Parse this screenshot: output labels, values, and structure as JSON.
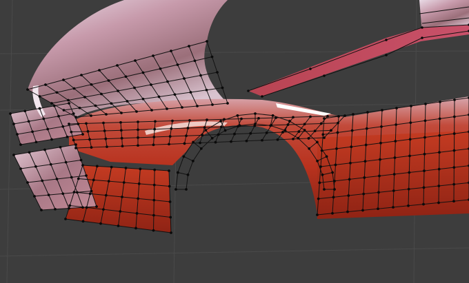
{
  "viewport": {
    "background": "#3d3d3d",
    "grid_color": "#4a4a4a",
    "axis_x_color": "#3f8f3f",
    "wire_color": "#111111",
    "vertex_color": "#0a0a0a"
  },
  "materials": {
    "paint_red": "#b8321e",
    "paint_red_dark": "#7a1d12",
    "paint_highlight": "#f2b8b0",
    "reflection_pink": "#c89aa8",
    "reflection_sky": "#e8d8e6"
  },
  "mesh": {
    "object": "car-body-panel",
    "mode": "edit-wireframe-overlay"
  }
}
